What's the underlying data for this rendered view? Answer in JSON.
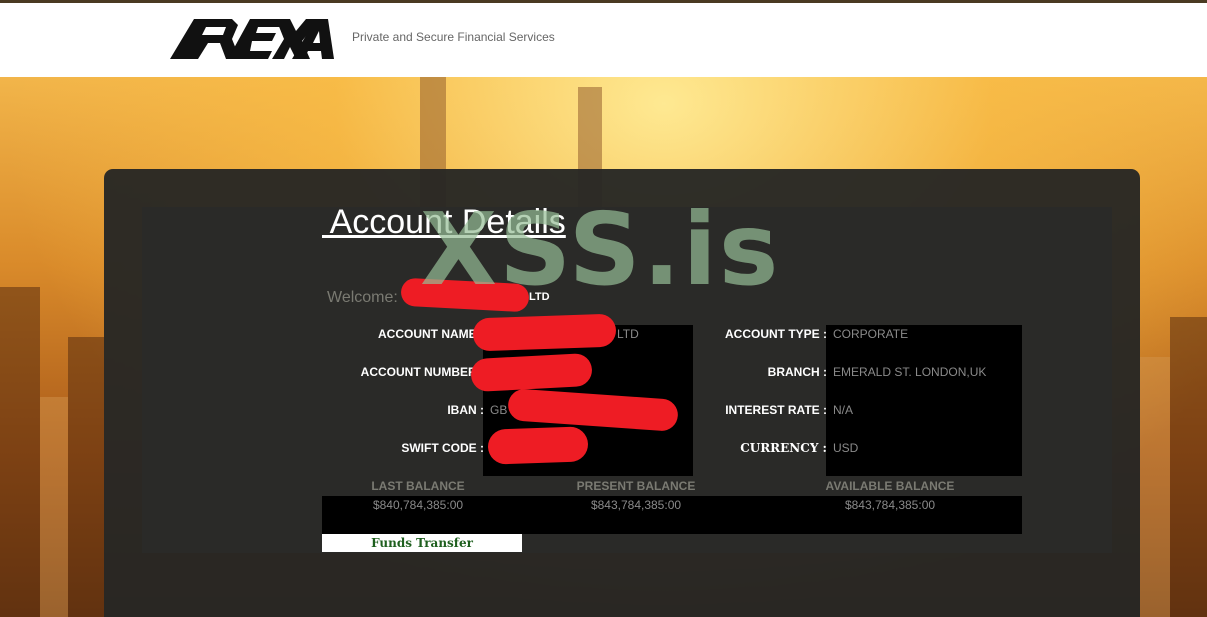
{
  "header": {
    "brand": "REXA",
    "tagline": "Private and Secure Financial Services"
  },
  "panel": {
    "title": " Account Details",
    "watermark": "XSS.is",
    "welcome_label": "Welcome:",
    "welcome_value": "LTD"
  },
  "details_left": [
    {
      "label": "ACCOUNT NAME :",
      "value": "LTD"
    },
    {
      "label": "ACCOUNT NUMBER :",
      "value": ""
    },
    {
      "label": "IBAN :",
      "value": "GB"
    },
    {
      "label": "SWIFT CODE :",
      "value": ""
    }
  ],
  "details_right": [
    {
      "label": "ACCOUNT TYPE :",
      "value": "CORPORATE"
    },
    {
      "label": "BRANCH :",
      "value": "EMERALD ST. LONDON,UK"
    },
    {
      "label": "INTEREST RATE :",
      "value": "N/A"
    },
    {
      "label": "CURRENCY :",
      "value": "USD"
    }
  ],
  "balances": [
    {
      "label": "LAST BALANCE",
      "value": "$840,784,385:00"
    },
    {
      "label": "PRESENT BALANCE",
      "value": "$843,784,385:00"
    },
    {
      "label": "AVAILABLE BALANCE",
      "value": "$843,784,385:00"
    }
  ],
  "actions": {
    "funds_transfer": "Funds Transfer"
  },
  "colors": {
    "redaction": "#ee1c24",
    "link_green": "#1e5f1e",
    "panel": "#262624"
  }
}
